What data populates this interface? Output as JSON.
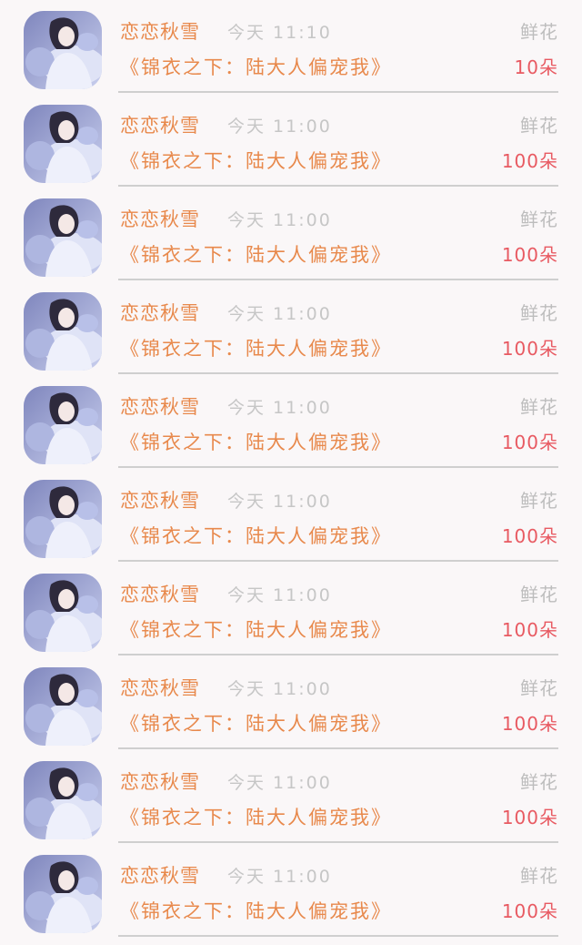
{
  "items": [
    {
      "name": "恋恋秋雪",
      "time": "今天 11:10",
      "gift_label": "鲜花",
      "title": "《锦衣之下：陆大人偏宠我》",
      "count": "10朵"
    },
    {
      "name": "恋恋秋雪",
      "time": "今天 11:00",
      "gift_label": "鲜花",
      "title": "《锦衣之下：陆大人偏宠我》",
      "count": "100朵"
    },
    {
      "name": "恋恋秋雪",
      "time": "今天 11:00",
      "gift_label": "鲜花",
      "title": "《锦衣之下：陆大人偏宠我》",
      "count": "100朵"
    },
    {
      "name": "恋恋秋雪",
      "time": "今天 11:00",
      "gift_label": "鲜花",
      "title": "《锦衣之下：陆大人偏宠我》",
      "count": "100朵"
    },
    {
      "name": "恋恋秋雪",
      "time": "今天 11:00",
      "gift_label": "鲜花",
      "title": "《锦衣之下：陆大人偏宠我》",
      "count": "100朵"
    },
    {
      "name": "恋恋秋雪",
      "time": "今天 11:00",
      "gift_label": "鲜花",
      "title": "《锦衣之下：陆大人偏宠我》",
      "count": "100朵"
    },
    {
      "name": "恋恋秋雪",
      "time": "今天 11:00",
      "gift_label": "鲜花",
      "title": "《锦衣之下：陆大人偏宠我》",
      "count": "100朵"
    },
    {
      "name": "恋恋秋雪",
      "time": "今天 11:00",
      "gift_label": "鲜花",
      "title": "《锦衣之下：陆大人偏宠我》",
      "count": "100朵"
    },
    {
      "name": "恋恋秋雪",
      "time": "今天 11:00",
      "gift_label": "鲜花",
      "title": "《锦衣之下：陆大人偏宠我》",
      "count": "100朵"
    },
    {
      "name": "恋恋秋雪",
      "time": "今天 11:00",
      "gift_label": "鲜花",
      "title": "《锦衣之下：陆大人偏宠我》",
      "count": "100朵"
    }
  ],
  "colors": {
    "name": "#e8894c",
    "title": "#e8894c",
    "time": "#c6c6c6",
    "gift_label": "#bdbdbd",
    "count": "#e85a62",
    "divider": "#cfcfcf"
  }
}
